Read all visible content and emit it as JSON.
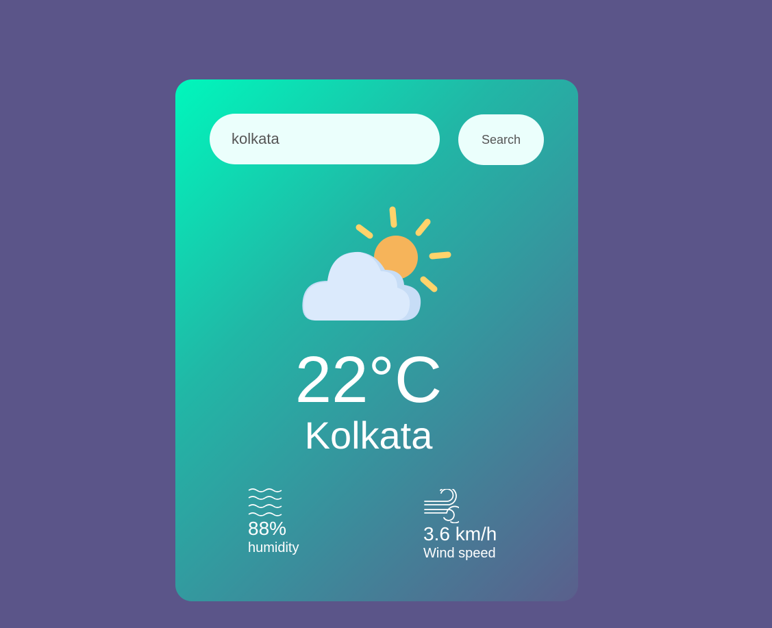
{
  "search": {
    "value": "kolkata",
    "button_label": "Search"
  },
  "weather": {
    "icon": "partly-cloudy-icon",
    "temperature": "22°C",
    "city": "Kolkata"
  },
  "humidity": {
    "icon": "humidity-waves-icon",
    "value": "88%",
    "label": "humidity"
  },
  "wind": {
    "icon": "wind-icon",
    "value": "3.6 km/h",
    "label": "Wind speed"
  },
  "colors": {
    "background": "#5b5589",
    "card_gradient_start": "#00f7bc",
    "card_gradient_end": "#5a5f8c",
    "input_background": "#ebfffc",
    "sun": "#f6b45a",
    "sun_rays": "#ffd36b",
    "cloud": "#dbeafc"
  }
}
